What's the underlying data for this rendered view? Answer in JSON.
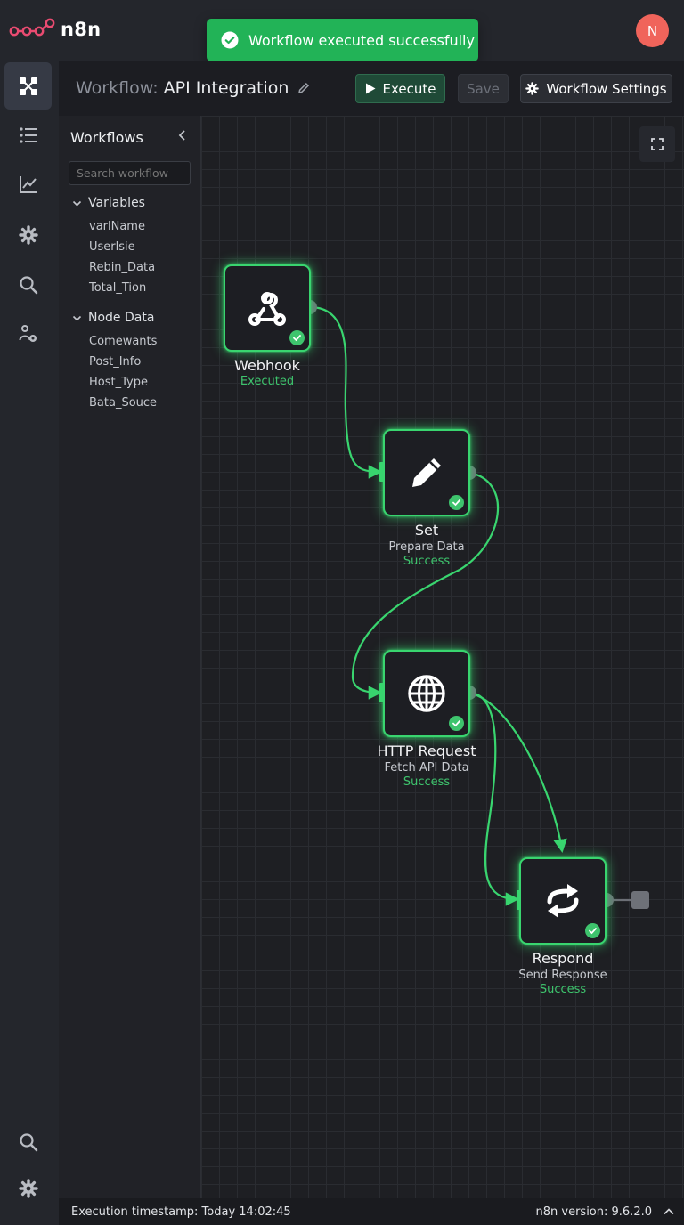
{
  "app": {
    "name": "n8n",
    "avatar_initial": "N"
  },
  "toast": {
    "message": "Workflow executed successfully"
  },
  "header": {
    "title_prefix": "Workflow:",
    "title_name": "API Integration",
    "execute_label": "Execute",
    "save_label": "Save",
    "settings_label": "Workflow Settings"
  },
  "rail": {
    "items": [
      "workflow-icon",
      "list-icon",
      "chart-icon",
      "gear-icon",
      "search-icon",
      "user-settings-icon"
    ],
    "bottom": [
      "search-icon",
      "gear-icon"
    ]
  },
  "panel": {
    "title": "Workflows",
    "search_placeholder": "Search workflow",
    "groups": [
      {
        "label": "Variables",
        "items": [
          "varlName",
          "Userlsie",
          "Rebin_Data",
          "Total_Tion"
        ]
      },
      {
        "label": "Node Data",
        "items": [
          "Comewants",
          "Post_Info",
          "Host_Type",
          "Bata_Souce"
        ]
      }
    ]
  },
  "nodes": [
    {
      "name": "Webhook",
      "subtitle": "",
      "status": "Executed",
      "icon": "webhook-icon"
    },
    {
      "name": "Set",
      "subtitle": "Prepare Data",
      "status": "Success",
      "icon": "pencil-icon"
    },
    {
      "name": "HTTP Request",
      "subtitle": "Fetch API Data",
      "status": "Success",
      "icon": "globe-icon"
    },
    {
      "name": "Respond",
      "subtitle": "Send Response",
      "status": "Success",
      "icon": "swap-arrows-icon"
    }
  ],
  "footer": {
    "timestamp": "Execution timestamp: Today 14:02:45",
    "version": "n8n version: 9.6.2.0"
  },
  "colors": {
    "accent": "#39d56f",
    "toast": "#22b357",
    "avatar": "#f0645b"
  }
}
